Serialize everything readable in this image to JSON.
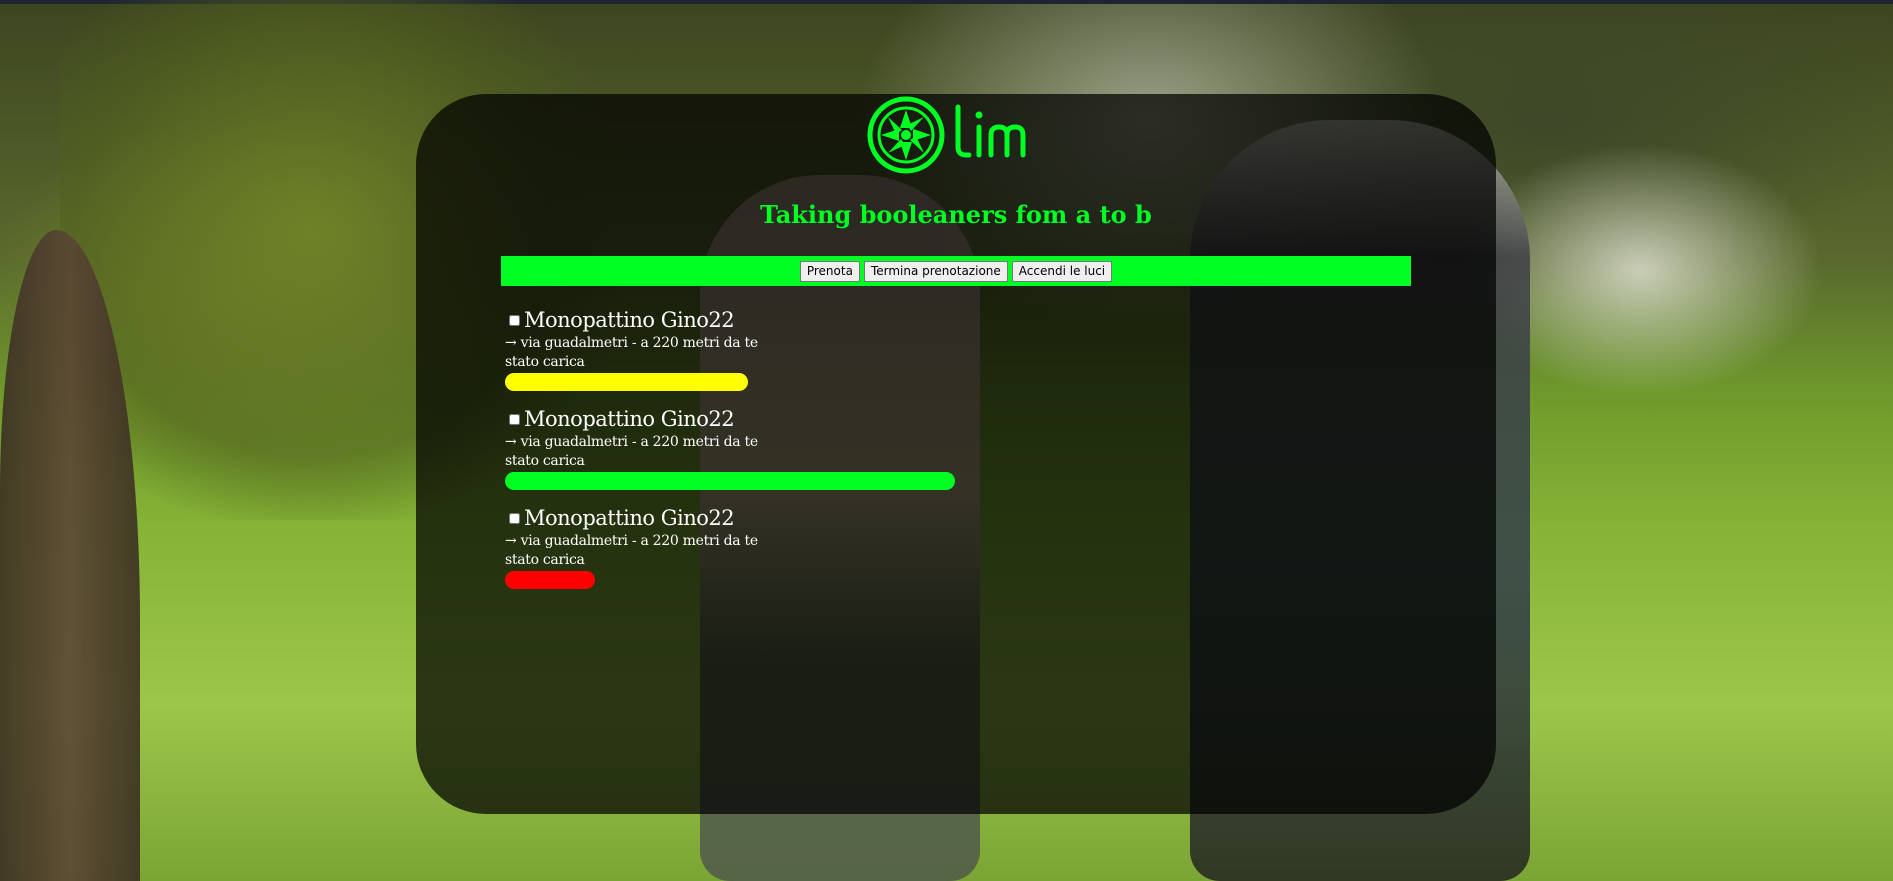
{
  "brand": {
    "logo_text": "Lim",
    "accent_color": "#00ff22"
  },
  "header": {
    "title": "Taking booleaners fom a to b"
  },
  "toolbar": {
    "book_label": "Prenota",
    "end_booking_label": "Termina prenotazione",
    "lights_label": "Accendi le luci"
  },
  "scooters": [
    {
      "name": "Monopattino Gino22",
      "location": "→ via guadalmetri - a 220 metri da te",
      "charge_label": "stato carica",
      "charge_level": 0.54,
      "charge_color": "#ffff00",
      "checked": false
    },
    {
      "name": "Monopattino Gino22",
      "location": "→ via guadalmetri - a 220 metri da te",
      "charge_label": "stato carica",
      "charge_level": 1.0,
      "charge_color": "#00ff22",
      "checked": false
    },
    {
      "name": "Monopattino Gino22",
      "location": "→ via guadalmetri - a 220 metri da te",
      "charge_label": "stato carica",
      "charge_level": 0.2,
      "charge_color": "#ff0000",
      "checked": false
    }
  ]
}
